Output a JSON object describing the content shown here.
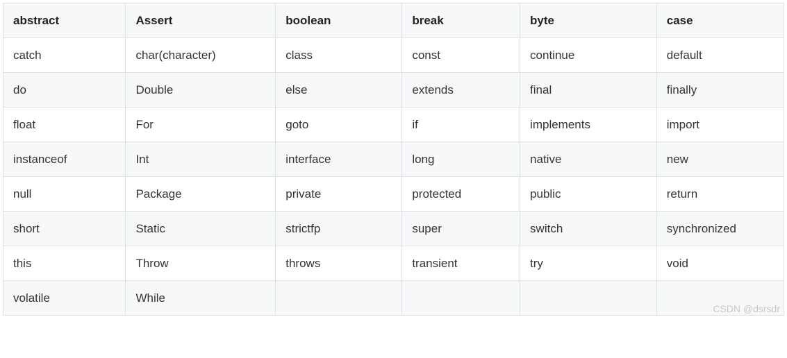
{
  "table": {
    "headers": [
      "abstract",
      "Assert",
      "boolean",
      "break",
      "byte",
      "case"
    ],
    "rows": [
      [
        "catch",
        "char(character)",
        "class",
        "const",
        "continue",
        "default"
      ],
      [
        "do",
        "Double",
        "else",
        "extends",
        "final",
        "finally"
      ],
      [
        "float",
        "For",
        "goto",
        "if",
        "implements",
        "import"
      ],
      [
        "instanceof",
        "Int",
        "interface",
        "long",
        "native",
        "new"
      ],
      [
        "null",
        "Package",
        "private",
        "protected",
        "public",
        "return"
      ],
      [
        "short",
        "Static",
        "strictfp",
        "super",
        "switch",
        "synchronized"
      ],
      [
        "this",
        "Throw",
        "throws",
        "transient",
        "try",
        "void"
      ],
      [
        "volatile",
        "While",
        "",
        "",
        "",
        ""
      ]
    ]
  },
  "watermark": "CSDN @dsrsdr"
}
